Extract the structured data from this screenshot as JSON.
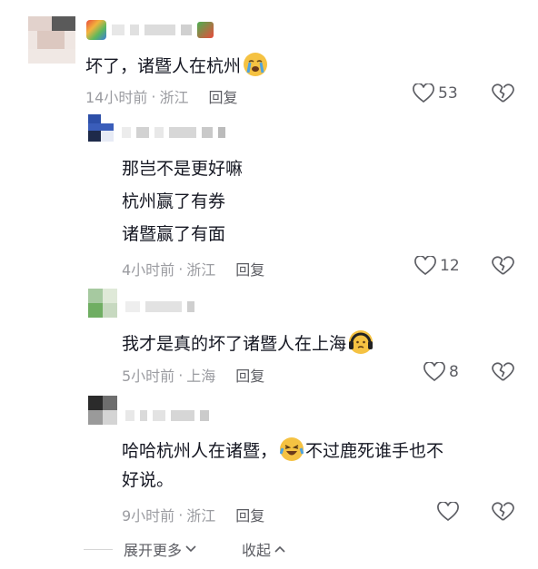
{
  "comments": [
    {
      "text": "坏了，诸暨人在杭州",
      "emoji": "crying-face-emoji",
      "time": "14小时前",
      "location": "浙江",
      "reply": "回复",
      "likes": "53"
    },
    {
      "lines": [
        "那岂不是更好嘛",
        "杭州赢了有券",
        "诸暨赢了有面"
      ],
      "time": "4小时前",
      "location": "浙江",
      "reply": "回复",
      "likes": "12"
    },
    {
      "text": "我才是真的坏了诸暨人在上海",
      "emoji": "headphone-face-emoji",
      "time": "5小时前",
      "location": "上海",
      "reply": "回复",
      "likes": "8"
    },
    {
      "text_before": "哈哈杭州人在诸暨，",
      "emoji": "laughing-crying-emoji",
      "text_after": "不过鹿死谁手也不",
      "text_line2": "好说。",
      "time": "9小时前",
      "location": "浙江",
      "reply": "回复",
      "likes": ""
    }
  ],
  "separator": "·",
  "footer": {
    "expand": "展开更多",
    "collapse": "收起"
  },
  "colors": {
    "text": "#161823",
    "meta": "#9b9ca1",
    "action": "#5c5d63",
    "emoji_yellow": "#f5c242"
  }
}
